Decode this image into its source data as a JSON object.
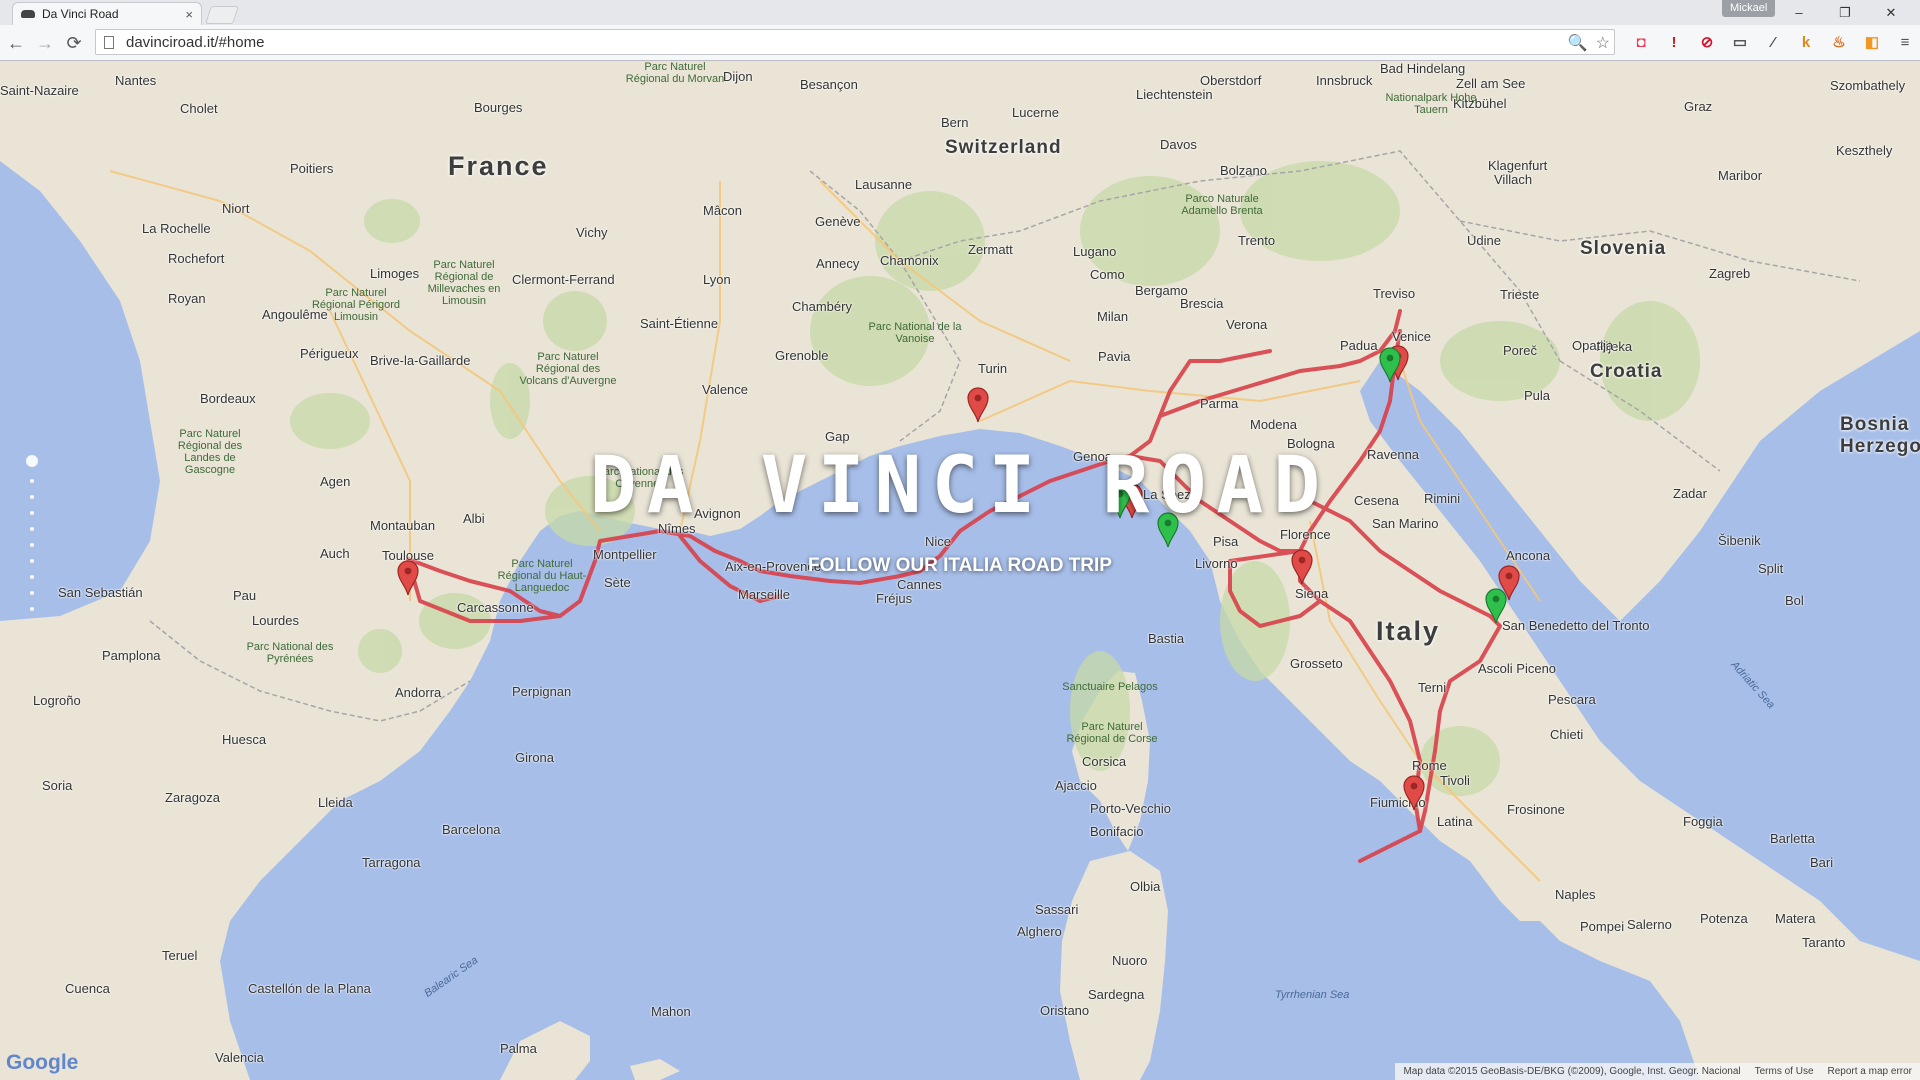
{
  "browser": {
    "tab_title": "Da Vinci Road",
    "tab_close": "×",
    "profile_name": "Mickael",
    "window_controls": [
      "–",
      "❐",
      "✕"
    ],
    "url": "davinciroad.it/#home",
    "nav": {
      "back": "←",
      "forward": "→",
      "reload": "⟳"
    },
    "omnibox_icons": [
      "🔍",
      "☆"
    ],
    "extensions": [
      {
        "icon": "pocket-icon",
        "glyph": "◘",
        "color": "#ef3f56"
      },
      {
        "icon": "lastpass-icon",
        "glyph": "!",
        "color": "#cc1d1d"
      },
      {
        "icon": "adblock-icon",
        "glyph": "⊘",
        "color": "#d3122b"
      },
      {
        "icon": "cast-icon",
        "glyph": "▭",
        "color": "#555555"
      },
      {
        "icon": "eyedropper-icon",
        "glyph": "⁄",
        "color": "#555555"
      },
      {
        "icon": "k-icon",
        "glyph": "k",
        "color": "#d98a22"
      },
      {
        "icon": "fire-icon",
        "glyph": "♨",
        "color": "#e06b1f"
      },
      {
        "icon": "rss-icon",
        "glyph": "◧",
        "color": "#f29721"
      },
      {
        "icon": "menu-icon",
        "glyph": "≡",
        "color": "#555555"
      }
    ]
  },
  "hero": {
    "title": "DA VINCI ROAD",
    "subtitle": "FOLLOW OUR ITALIA ROAD TRIP"
  },
  "dot_nav": {
    "count": 10,
    "active_index": 0
  },
  "map": {
    "countries": [
      "France",
      "Switzerland",
      "Liechtenstein",
      "Italy",
      "Slovenia",
      "Croatia",
      "Bosnia Herzego",
      "Andorra",
      "San Marino"
    ],
    "cities": [
      "Nantes",
      "Saint-Nazaire",
      "Cholet",
      "Poitiers",
      "Niort",
      "La Rochelle",
      "Rochefort",
      "Royan",
      "Angoulême",
      "Limoges",
      "Périgueux",
      "Brive-la-Gaillarde",
      "Bordeaux",
      "Agen",
      "Montauban",
      "Toulouse",
      "Albi",
      "Auch",
      "Pau",
      "Lourdes",
      "Carcassonne",
      "Perpignan",
      "Montpellier",
      "Nîmes",
      "Avignon",
      "Sète",
      "Aix-en-Provence",
      "Marseille",
      "Cannes",
      "Nice",
      "Fréjus",
      "Clermont-Ferrand",
      "Vichy",
      "Lyon",
      "Saint-Étienne",
      "Grenoble",
      "Valence",
      "Gap",
      "Chambéry",
      "Annecy",
      "Genève",
      "Lausanne",
      "Chamonix",
      "Zermatt",
      "Bern",
      "Lucerne",
      "Lugano",
      "Como",
      "Milan",
      "Bergamo",
      "Brescia",
      "Verona",
      "Padua",
      "Venice",
      "Treviso",
      "Trento",
      "Bolzano",
      "Udine",
      "Trieste",
      "Turin",
      "Pavia",
      "Parma",
      "Modena",
      "Bologna",
      "Ravenna",
      "Rimini",
      "Cesena",
      "Genoa",
      "La Spezia",
      "Pisa",
      "Livorno",
      "Florence",
      "Siena",
      "Grosseto",
      "Ancona",
      "Ascoli Piceno",
      "San Benedetto del Tronto",
      "Pescara",
      "Chieti",
      "Terni",
      "Rome",
      "Tivoli",
      "Fiumicino",
      "Latina",
      "Frosinone",
      "Foggia",
      "Barletta",
      "Bari",
      "Naples",
      "Salerno",
      "Potenza",
      "Matera",
      "Taranto",
      "Pompei",
      "Ajaccio",
      "Corsica",
      "Bastia",
      "Porto-Vecchio",
      "Bonifacio",
      "Olbia",
      "Sassari",
      "Alghero",
      "Nuoro",
      "Oristano",
      "Sardegna",
      "Barcelona",
      "Tarragona",
      "Lleida",
      "Girona",
      "Zaragoza",
      "Huesca",
      "Pamplona",
      "Logroño",
      "Soria",
      "Teruel",
      "Castellón de la Plana",
      "Valencia",
      "Cuenca",
      "Palma",
      "Mahon",
      "San Sebastián",
      "Dijon",
      "Besançon",
      "Bourges",
      "Mâcon",
      "Innsbruck",
      "Klagenfurt",
      "Villach",
      "Graz",
      "Zagreb",
      "Rijeka",
      "Pula",
      "Poreč",
      "Opatija",
      "Zadar",
      "Šibenik",
      "Split",
      "Bol",
      "Maribor",
      "Szombathely",
      "Keszthely",
      "Davos",
      "Oberstdorf",
      "Kitzbühel",
      "Zell am See",
      "Bad Hindelang"
    ],
    "seas": [
      "Balearic Sea",
      "Tyrrhenian Sea",
      "Adriatic Sea"
    ],
    "parks": [
      "Parc Naturel Régional du Morvan",
      "Parc Naturel Régional de Millevaches en Limousin",
      "Parc Naturel Régional Périgord Limousin",
      "Parc Naturel Régional des Volcans d'Auvergne",
      "Parc Naturel Régional des Landes de Gascogne",
      "Parc National des Cévennes",
      "Parc Naturel Régional du Haut-Languedoc",
      "Parc National des Pyrénées",
      "Parc National de la Vanoise",
      "Parc Naturel Régional de Corse",
      "Parco Naturale Adamello Brenta",
      "Nationalpark Hohe Tauern",
      "Sanctuaire Pelagos"
    ],
    "attribution": "Map data ©2015 GeoBasis-DE/BKG (©2009), Google, Inst. Geogr. Nacional",
    "terms": "Terms of Use",
    "report": "Report a map error",
    "google_logo": "Google",
    "markers": [
      {
        "name": "Toulouse",
        "color": "red"
      },
      {
        "name": "Turin",
        "color": "red"
      },
      {
        "name": "Genoa",
        "color": "red"
      },
      {
        "name": "Genoa",
        "color": "green"
      },
      {
        "name": "La Spezia",
        "color": "green"
      },
      {
        "name": "Florence",
        "color": "red"
      },
      {
        "name": "Venice",
        "color": "red"
      },
      {
        "name": "Venice",
        "color": "green"
      },
      {
        "name": "Ancona",
        "color": "red"
      },
      {
        "name": "Ancona",
        "color": "green"
      },
      {
        "name": "Rome",
        "color": "red"
      }
    ],
    "route_color": "#d9404a"
  }
}
